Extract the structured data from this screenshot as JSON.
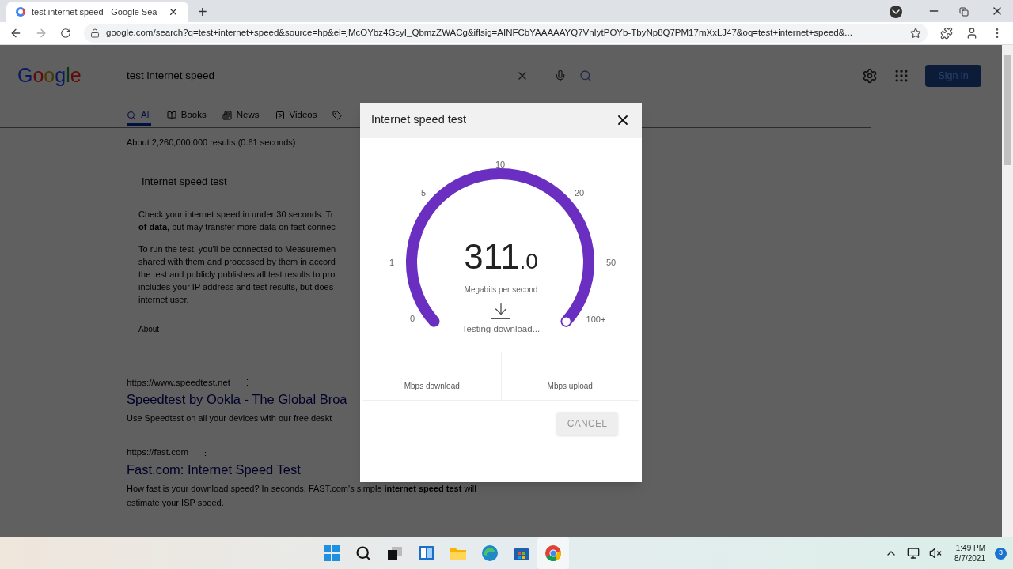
{
  "browser": {
    "tab_title": "test internet speed - Google Sea",
    "new_tab": "+",
    "url": "google.com/search?q=test+internet+speed&source=hp&ei=jMcOYbz4GcyI_QbmzZWACg&iflsig=AINFCbYAAAAAYQ7VnIytPOYb-TbyNp8Q7PM17mXxLJ47&oq=test+internet+speed&..."
  },
  "google": {
    "logo": "Google",
    "query": "test internet speed",
    "sign_in": "Sign in",
    "tabs": [
      {
        "label": "All",
        "selected": true,
        "kind": "search"
      },
      {
        "label": "Books",
        "selected": false,
        "kind": "book"
      },
      {
        "label": "News",
        "selected": false,
        "kind": "news"
      },
      {
        "label": "Videos",
        "selected": false,
        "kind": "video"
      },
      {
        "selected": false,
        "kind": "tag"
      }
    ],
    "result_stats": "About 2,260,000,000 results (0.61 seconds)",
    "card": {
      "title": "Internet speed test",
      "paragraphs": [
        [
          "Check your internet speed in under 30 seconds. Tr",
          "**of data**, but may transfer more data on fast connec"
        ],
        [
          "To run the test, you'll be connected to Measuremen",
          "shared with them and processed by them in accord",
          "the test and publicly publishes all test results to pro",
          "includes your IP address and test results, but does",
          "internet user."
        ]
      ],
      "about": "About"
    },
    "results": [
      {
        "url": "https://www.speedtest.net",
        "menu": "⋮",
        "title": "Speedtest by Ookla - The Global Broa",
        "snippet": [
          "Use Speedtest on all your devices with our free deskt"
        ]
      },
      {
        "url": "https://fast.com",
        "menu": "⋮",
        "title": "Fast.com: Internet Speed Test",
        "snippet": [
          "How fast is your download speed? In seconds, FAST.com's simple **internet speed test** will",
          "estimate your ISP speed."
        ]
      }
    ]
  },
  "dialog": {
    "title": "Internet speed test",
    "gauge": {
      "level": 1,
      "ticks": [
        "0",
        "1",
        "5",
        "10",
        "20",
        "50",
        "100+"
      ],
      "value": "311",
      "decimal": ".0",
      "unit": "Megabits per second",
      "status": "Testing download..."
    },
    "stats": [
      {
        "label": "Mbps download"
      },
      {
        "label": "Mbps upload"
      }
    ],
    "cancel": "CANCEL"
  },
  "taskbar": {
    "time": "1:49 PM",
    "date": "8/7/2021",
    "notifications": "3"
  }
}
